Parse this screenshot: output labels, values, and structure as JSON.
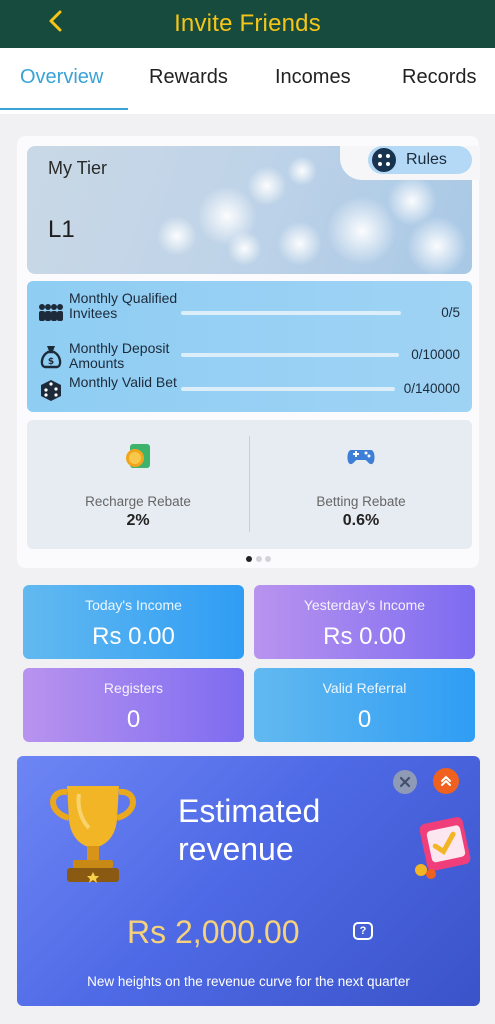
{
  "header": {
    "title": "Invite Friends",
    "back_icon": "chevron-left-icon"
  },
  "tabs": [
    {
      "label": "Overview",
      "active": true
    },
    {
      "label": "Rewards",
      "active": false
    },
    {
      "label": "Incomes",
      "active": false
    },
    {
      "label": "Records",
      "active": false
    }
  ],
  "tier": {
    "label": "My Tier",
    "level": "L1",
    "rules_label": "Rules",
    "progress": [
      {
        "label": "Monthly Qualified Invitees",
        "value": "0/5",
        "icon": "people-icon"
      },
      {
        "label": "Monthly Deposit Amounts",
        "value": "0/10000",
        "icon": "money-bag-icon"
      },
      {
        "label": "Monthly Valid Bet",
        "value": "0/140000",
        "icon": "dice-icon"
      }
    ],
    "rebates": [
      {
        "name": "Recharge Rebate",
        "percent": "2%",
        "icon": "coins-icon"
      },
      {
        "name": "Betting Rebate",
        "percent": "0.6%",
        "icon": "gamepad-icon"
      }
    ],
    "pager": {
      "pages": 3,
      "current": 1
    }
  },
  "stats": {
    "today": {
      "caption": "Today's Income",
      "value": "Rs  0.00"
    },
    "yesterday": {
      "caption": "Yesterday's Income",
      "value": "Rs  0.00"
    },
    "registers": {
      "caption": "Registers",
      "value": "0"
    },
    "valid_referral": {
      "caption": "Valid Referral",
      "value": "0"
    }
  },
  "revenue": {
    "heading_line1": "Estimated",
    "heading_line2": "revenue",
    "amount": "Rs  2,000.00",
    "tagline": "New heights on the revenue curve for the next quarter",
    "help_symbol": "?"
  },
  "colors": {
    "header_bg": "#174b3d",
    "header_title": "#f5c518",
    "tab_active": "#3aa3d6",
    "amount_gold": "#f6d27a",
    "accent_orange": "#f0611f"
  }
}
